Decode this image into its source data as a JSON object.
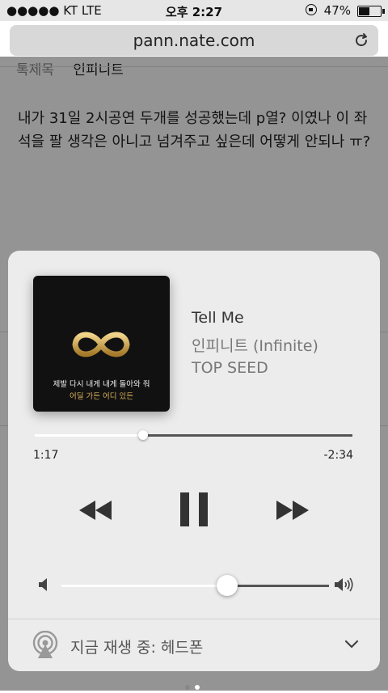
{
  "status": {
    "carrier": "●●●●● KT   LTE",
    "time": "오후 2:27",
    "battery": "47%"
  },
  "browser": {
    "url": "pann.nate.com"
  },
  "webpage": {
    "tabs": [
      "톡제목",
      "인피니트"
    ],
    "post_text": "내가 31일 2시공연 두개를 성공했는데 p열? 이였나 이 좌석을 팔 생각은 아니고 넘겨주고 싶은데 어떻게 안되나 ㅠ?"
  },
  "player": {
    "album_art": {
      "line1": "제발 다시 내게 내게 돌아와 줘",
      "line2": "어딜 가든 어디 있든",
      "accent_color": "#c9a24a"
    },
    "song_title": "Tell Me",
    "artist": "인피니트 (Infinite)",
    "album": "TOP SEED",
    "elapsed": "1:17",
    "remaining": "-2:34",
    "progress": 0.34,
    "volume": 0.62,
    "output_label": "지금 재생 중: 헤드폰"
  },
  "page_indicator": {
    "count": 2,
    "active": 1
  }
}
